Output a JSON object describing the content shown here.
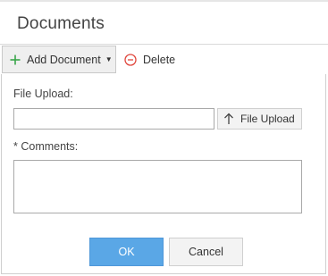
{
  "panel": {
    "title": "Documents"
  },
  "toolbar": {
    "add_document_label": "Add Document",
    "delete_label": "Delete"
  },
  "dialog": {
    "file_upload_label": "File Upload:",
    "file_input_value": "",
    "file_upload_button_label": "File Upload",
    "comments_label": "* Comments:",
    "comments_value": "",
    "ok_label": "OK",
    "cancel_label": "Cancel"
  },
  "colors": {
    "accent_plus": "#3aa64a",
    "delete_red": "#e0463c",
    "ok_blue": "#5aa7e6"
  },
  "icons": [
    "plus-icon",
    "caret-down-icon",
    "minus-circle-icon",
    "arrow-up-icon"
  ]
}
